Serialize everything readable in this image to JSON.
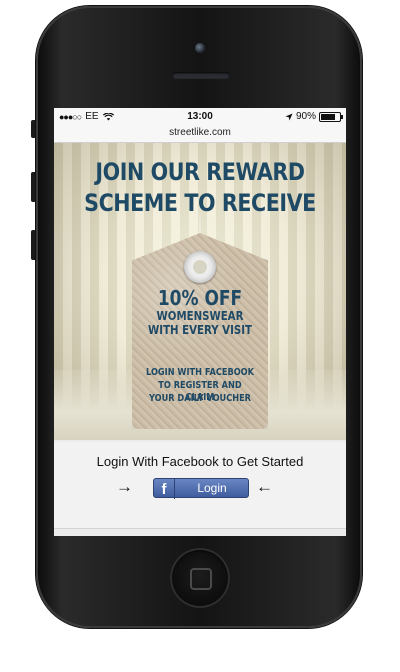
{
  "statusbar": {
    "carrier": "EE",
    "time": "13:00",
    "battery": "90%",
    "battery_level": 0.9
  },
  "browser": {
    "url": "streetlike.com"
  },
  "banner": {
    "headline_line1": "JOIN OUR REWARD",
    "headline_line2": "SCHEME TO RECEIVE",
    "tag_line1": "10% OFF",
    "tag_line2": "WOMENSWEAR",
    "tag_line3": "WITH EVERY VISIT",
    "tag_line4": "LOGIN WITH FACEBOOK",
    "tag_line5": "TO REGISTER AND CLAIM",
    "tag_line6": "YOUR DAILY VOUCHER"
  },
  "login": {
    "prompt": "Login With Facebook to Get Started",
    "arrow_left": "→",
    "arrow_right": "←",
    "fb_icon_glyph": "f",
    "button_label": "Login"
  },
  "colors": {
    "headline": "#1f4a66",
    "facebook": "#3f5d9e"
  }
}
